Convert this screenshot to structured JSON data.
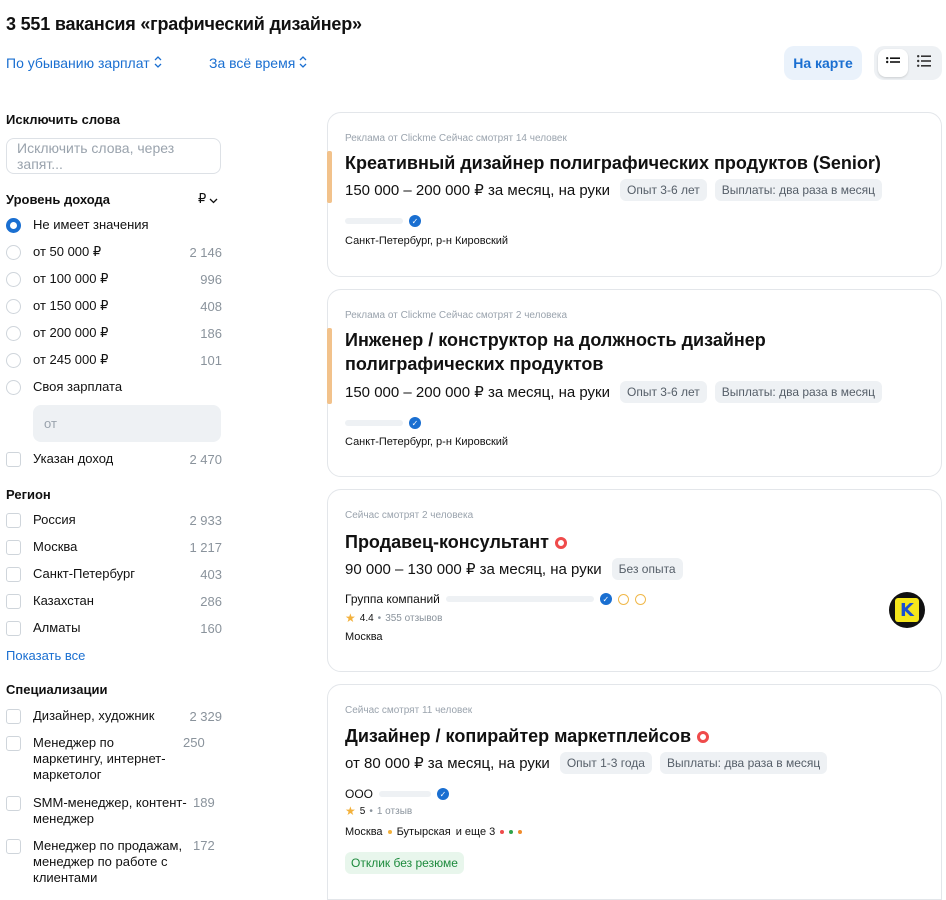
{
  "header": {
    "title": "3 551 вакансия «графический дизайнер»",
    "sort_salary": "По убыванию зарплат",
    "sort_time": "За всё время",
    "map_button": "На карте"
  },
  "filters": {
    "exclude_title": "Исключить слова",
    "exclude_placeholder": "Исключить слова, через запят...",
    "income_title": "Уровень дохода",
    "currency": "₽",
    "income_options": [
      {
        "label": "Не имеет значения",
        "count": ""
      },
      {
        "label": "от 50 000 ₽",
        "count": "2 146"
      },
      {
        "label": "от 100 000 ₽",
        "count": "996"
      },
      {
        "label": "от 150 000 ₽",
        "count": "408"
      },
      {
        "label": "от 200 000 ₽",
        "count": "186"
      },
      {
        "label": "от 245 000 ₽",
        "count": "101"
      },
      {
        "label": "Своя зарплата",
        "count": ""
      }
    ],
    "salary_placeholder": "от",
    "income_specified": {
      "label": "Указан доход",
      "count": "2 470"
    },
    "region_title": "Регион",
    "regions": [
      {
        "label": "Россия",
        "count": "2 933"
      },
      {
        "label": "Москва",
        "count": "1 217"
      },
      {
        "label": "Санкт-Петербург",
        "count": "403"
      },
      {
        "label": "Казахстан",
        "count": "286"
      },
      {
        "label": "Алматы",
        "count": "160"
      }
    ],
    "show_all": "Показать все",
    "spec_title": "Специализации",
    "specs": [
      {
        "label": "Дизайнер, художник",
        "count": "2 329"
      },
      {
        "label": "Менеджер по маркетингу, интернет-маркетолог",
        "count": "250"
      },
      {
        "label": "SMM-менеджер, контент-менеджер",
        "count": "189"
      },
      {
        "label": "Менеджер по продажам, менеджер по работе с клиентами",
        "count": "172"
      }
    ]
  },
  "vacancies": [
    {
      "meta": "Реклама от Clickme   Сейчас смотрят 14 человек",
      "title": "Креативный дизайнер полиграфических продуктов (Senior)",
      "salary": "150 000 – 200 000 ₽ за месяц, на руки",
      "tags": [
        "Опыт 3-6 лет",
        "Выплаты: два раза в месяц"
      ],
      "location": "Санкт-Петербург, р-н Кировский"
    },
    {
      "meta": "Реклама от Clickme   Сейчас смотрят 2 человека",
      "title": "Инженер / конструктор на должность дизайнер полиграфических продуктов",
      "salary": "150 000 – 200 000 ₽ за месяц, на руки",
      "tags": [
        "Опыт 3-6 лет",
        "Выплаты: два раза в месяц"
      ],
      "location": "Санкт-Петербург, р-н Кировский"
    },
    {
      "meta": "Сейчас смотрят 2 человека",
      "title": "Продавец-консультант",
      "salary": "90 000 – 130 000 ₽ за месяц, на руки",
      "tags": [
        "Без опыта"
      ],
      "company": "Группа компаний",
      "rating": "4.4",
      "reviews": "355 отзывов",
      "location": "Москва"
    },
    {
      "meta": "Сейчас смотрят 11 человек",
      "title": "Дизайнер / копирайтер маркетплейсов",
      "salary": "от 80 000 ₽ за месяц, на руки",
      "tags": [
        "Опыт 1-3 года",
        "Выплаты: два раза в месяц"
      ],
      "company": "ООО",
      "rating": "5",
      "reviews": "1 отзыв",
      "location": "Москва",
      "metro": "Бутырская",
      "metro_more": "и еще 3",
      "respond": "Отклик без резюме"
    }
  ],
  "colors": {
    "accent": "#1a6fd1",
    "ad_stripe": "#f2c28b",
    "hot": "#ef4b4b",
    "respond": "#1c8a3c"
  },
  "icons": [
    "chevron-updown-icon",
    "list-view-icon",
    "detail-view-icon",
    "verified-icon",
    "star-icon",
    "hot-icon"
  ]
}
